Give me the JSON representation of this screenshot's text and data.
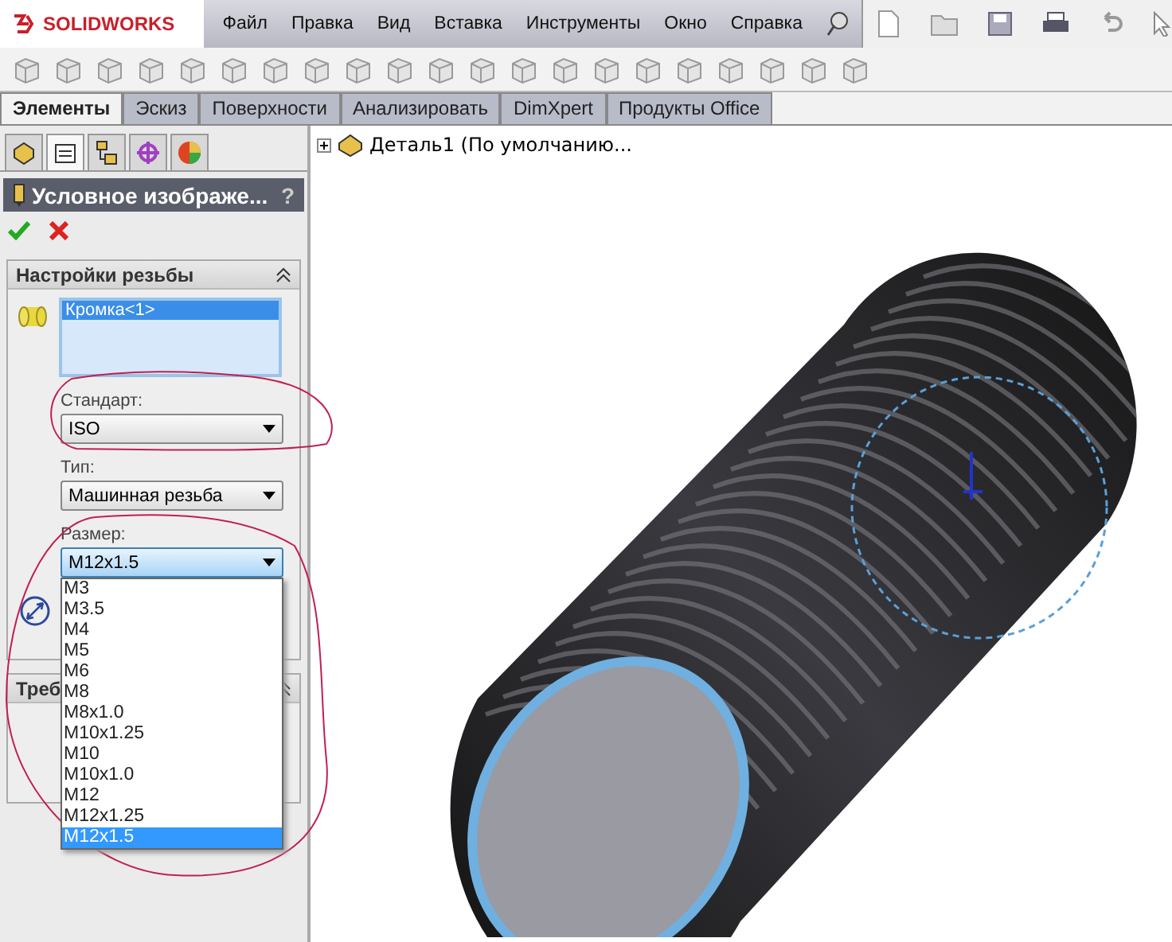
{
  "app": {
    "logo": "SOLIDWORKS"
  },
  "menu": [
    "Файл",
    "Правка",
    "Вид",
    "Вставка",
    "Инструменты",
    "Окно",
    "Справка"
  ],
  "tabs": [
    {
      "label": "Элементы",
      "selected": true
    },
    {
      "label": "Эскиз",
      "selected": false
    },
    {
      "label": "Поверхности",
      "selected": false
    },
    {
      "label": "Анализировать",
      "selected": false
    },
    {
      "label": "DimXpert",
      "selected": false
    },
    {
      "label": "Продукты Office",
      "selected": false
    }
  ],
  "panel_tabs": [
    {
      "selected": false
    },
    {
      "selected": true
    },
    {
      "selected": false
    },
    {
      "selected": false
    },
    {
      "selected": false
    }
  ],
  "property_manager": {
    "title": "Условное изображе...",
    "help": "?",
    "section": {
      "title": "Настройки резьбы",
      "selection": "Кромка<1>",
      "standard": {
        "label": "Стандарт:",
        "value": "ISO"
      },
      "type": {
        "label": "Тип:",
        "value": "Машинная резьба"
      },
      "size": {
        "label": "Размер:",
        "value": "M12x1.5",
        "expanded": true,
        "options": [
          {
            "label": "M3",
            "selected": false
          },
          {
            "label": "M3.5",
            "selected": false
          },
          {
            "label": "M4",
            "selected": false
          },
          {
            "label": "M5",
            "selected": false
          },
          {
            "label": "M6",
            "selected": false
          },
          {
            "label": "M8",
            "selected": false
          },
          {
            "label": "M8x1.0",
            "selected": false
          },
          {
            "label": "M10x1.25",
            "selected": false
          },
          {
            "label": "M10",
            "selected": false
          },
          {
            "label": "M10x1.0",
            "selected": false
          },
          {
            "label": "M12",
            "selected": false
          },
          {
            "label": "M12x1.25",
            "selected": false
          },
          {
            "label": "M12x1.5",
            "selected": true
          }
        ]
      }
    },
    "section_2": {
      "title": "Треб"
    }
  },
  "tree": {
    "root": {
      "label": "Деталь1  (По умолчанию...",
      "expanded": false
    }
  }
}
